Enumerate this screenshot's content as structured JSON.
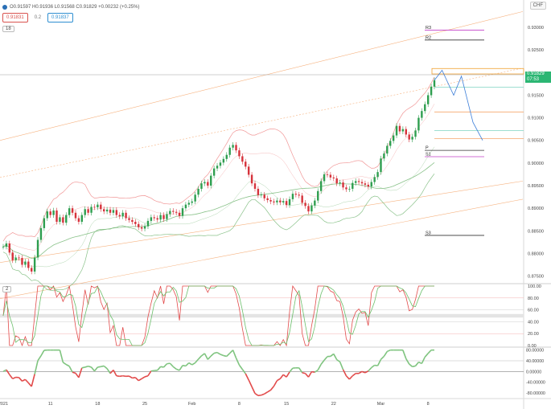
{
  "header": {
    "ohlc_text": "O0.91597 H0.91936 L0.91568 C0.91829 +0.00232 (+0.25%)",
    "ma1_value": "0.91831",
    "ma_sep": "0.2",
    "ma2_value": "0.91837",
    "indicator_main": "18",
    "indicator_stoch": "2",
    "currency": "CHF",
    "price_flag_value": "0.91829",
    "price_flag_time": "07:53"
  },
  "colors": {
    "up": "#2e9e4f",
    "down": "#d6323b",
    "bands_upper": "#f08c8c",
    "bands_mid": "#7dbb7d",
    "channel": "#f5a66b",
    "pivot_magenta": "#c33fc9",
    "projection": "#3b7dd8",
    "price_flag_bg": "#2bb673",
    "stoch_k": "#e24b4b",
    "stoch_d": "#6bbf6b",
    "momentum": "#7fc47f"
  },
  "chart_data": {
    "type": "candlestick",
    "title": "",
    "xlabel": "",
    "ylabel": "",
    "price_axis_ticks": [
      "0.93000",
      "0.92500",
      "0.92000",
      "0.91500",
      "0.91000",
      "0.90500",
      "0.90000",
      "0.89500",
      "0.89000",
      "0.88500",
      "0.88000",
      "0.87500"
    ],
    "ylim": [
      0.8735,
      0.9325
    ],
    "x_tick_labels": [
      "2021",
      "11",
      "18",
      "25",
      "Feb",
      "8",
      "15",
      "22",
      "Mar",
      "8"
    ],
    "x_tick_index": [
      0,
      15,
      30,
      45,
      60,
      75,
      90,
      105,
      120,
      135
    ],
    "series_close": [
      0.8815,
      0.8822,
      0.8802,
      0.8785,
      0.8791,
      0.879,
      0.8775,
      0.8782,
      0.8768,
      0.876,
      0.8791,
      0.883,
      0.8856,
      0.8878,
      0.8893,
      0.8885,
      0.8895,
      0.887,
      0.888,
      0.8868,
      0.8885,
      0.89,
      0.889,
      0.8878,
      0.887,
      0.8885,
      0.8898,
      0.889,
      0.8903,
      0.8902,
      0.8908,
      0.8898,
      0.8893,
      0.8897,
      0.889,
      0.8896,
      0.8885,
      0.8882,
      0.889,
      0.8878,
      0.8874,
      0.887,
      0.8865,
      0.8858,
      0.8855,
      0.886,
      0.8872,
      0.888,
      0.8878,
      0.8875,
      0.8885,
      0.8876,
      0.8887,
      0.8894,
      0.8892,
      0.889,
      0.8883,
      0.89,
      0.8908,
      0.8912,
      0.8915,
      0.893,
      0.8943,
      0.8955,
      0.8958,
      0.895,
      0.8972,
      0.8988,
      0.8994,
      0.9001,
      0.9009,
      0.9018,
      0.9034,
      0.904,
      0.9028,
      0.9015,
      0.9003,
      0.8992,
      0.8974,
      0.8955,
      0.8943,
      0.8929,
      0.893,
      0.8922,
      0.8918,
      0.8915,
      0.8913,
      0.8917,
      0.8913,
      0.8916,
      0.8907,
      0.892,
      0.8932,
      0.893,
      0.8928,
      0.8912,
      0.8905,
      0.8893,
      0.8906,
      0.8917,
      0.8938,
      0.896,
      0.8975,
      0.8974,
      0.8968,
      0.8966,
      0.8955,
      0.8957,
      0.8946,
      0.8942,
      0.8943,
      0.8956,
      0.896,
      0.8958,
      0.8955,
      0.8952,
      0.8948,
      0.8958,
      0.8969,
      0.898,
      0.901,
      0.9021,
      0.9038,
      0.9049,
      0.9061,
      0.9082,
      0.907,
      0.9075,
      0.9063,
      0.9052,
      0.9058,
      0.9072,
      0.91,
      0.9115,
      0.913,
      0.915,
      0.9169,
      0.9183
    ],
    "levels": [
      {
        "label": "R3",
        "price": 0.9294
      },
      {
        "label": "R2",
        "price": 0.9272
      },
      {
        "label": "P",
        "price": 0.9028
      },
      {
        "label": "S1",
        "price": 0.9014
      },
      {
        "label": "S3",
        "price": 0.884
      }
    ],
    "stoch_ticks": [
      "100.00",
      "80.00",
      "60.00",
      "40.00",
      "20.00",
      "0.00"
    ],
    "stoch_ylim": [
      0,
      100
    ],
    "momentum_ticks": [
      "80.00000",
      "40.00000",
      "0.00000",
      "-40.00000",
      "-80.00000"
    ],
    "momentum_ylim": [
      -95,
      85
    ]
  }
}
